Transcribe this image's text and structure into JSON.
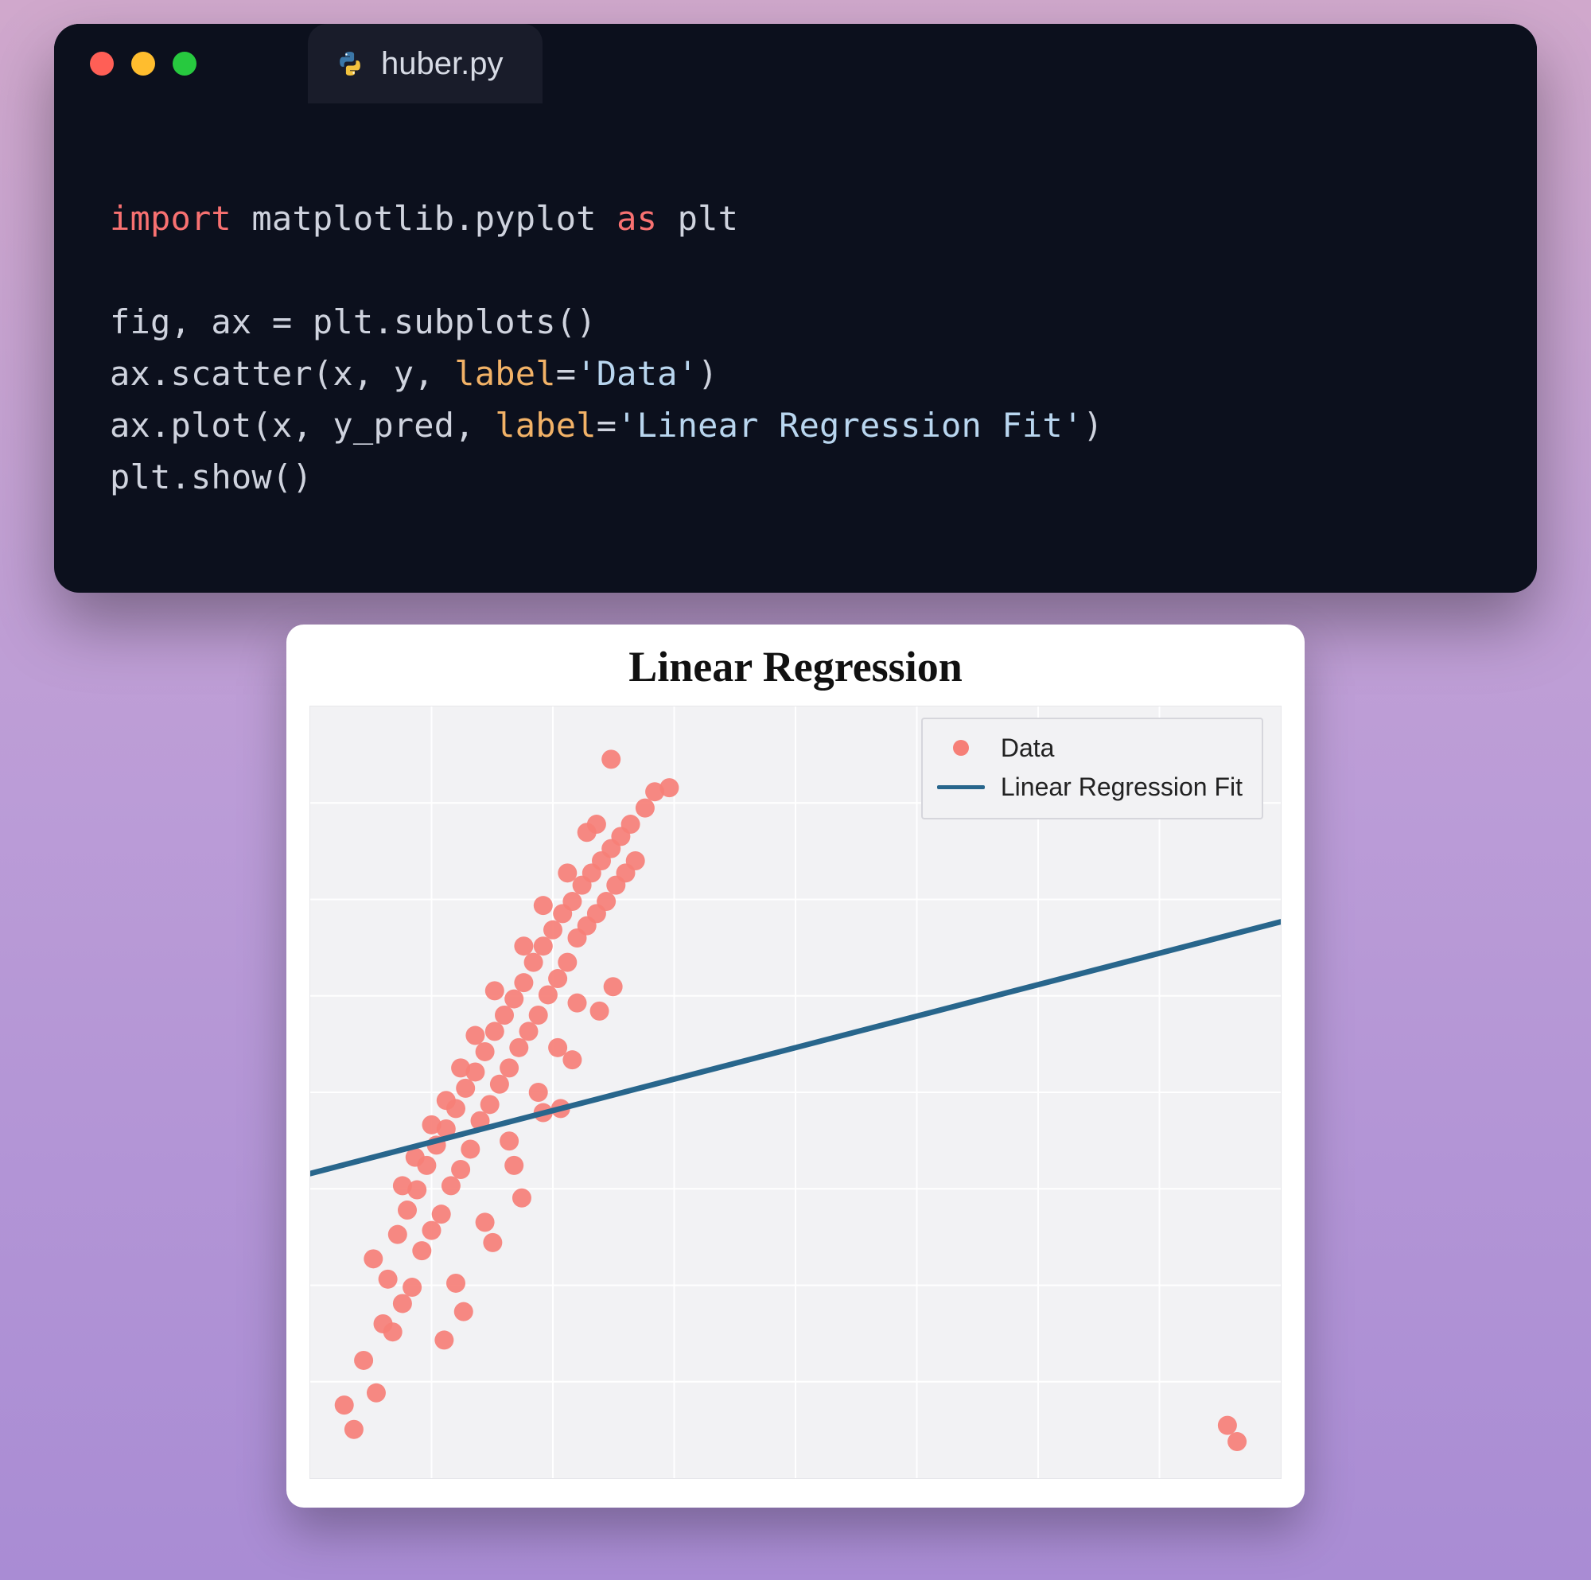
{
  "editor": {
    "tab_filename": "huber.py",
    "code_tokens": [
      [
        {
          "t": "import ",
          "c": "tok-kw"
        },
        {
          "t": "matplotlib.pyplot ",
          "c": "tok-id"
        },
        {
          "t": "as ",
          "c": "tok-kw"
        },
        {
          "t": "plt",
          "c": "tok-id"
        }
      ],
      [],
      [
        {
          "t": "fig, ax ",
          "c": "tok-id"
        },
        {
          "t": "= ",
          "c": "tok-op"
        },
        {
          "t": "plt.subplots()",
          "c": "tok-id"
        }
      ],
      [
        {
          "t": "ax.scatter(x, y, ",
          "c": "tok-id"
        },
        {
          "t": "label",
          "c": "tok-param"
        },
        {
          "t": "=",
          "c": "tok-op"
        },
        {
          "t": "'Data'",
          "c": "tok-str"
        },
        {
          "t": ")",
          "c": "tok-id"
        }
      ],
      [
        {
          "t": "ax.plot(x, y_pred, ",
          "c": "tok-id"
        },
        {
          "t": "label",
          "c": "tok-param"
        },
        {
          "t": "=",
          "c": "tok-op"
        },
        {
          "t": "'Linear Regression Fit'",
          "c": "tok-str"
        },
        {
          "t": ")",
          "c": "tok-id"
        }
      ],
      [
        {
          "t": "plt.show()",
          "c": "tok-id"
        }
      ]
    ]
  },
  "colors": {
    "scatter": "#f67f77",
    "line": "#28668c",
    "grid_bg": "#f2f2f4",
    "grid_line": "#ffffff"
  },
  "chart_data": {
    "type": "scatter+line",
    "title": "Linear Regression",
    "xlabel": "",
    "ylabel": "",
    "xlim": [
      0,
      10
    ],
    "ylim": [
      -1.5,
      8.0
    ],
    "grid": true,
    "legend_position": "upper right",
    "series": [
      {
        "name": "Data",
        "type": "scatter",
        "color": "#f67f77",
        "points": [
          [
            0.35,
            -0.6
          ],
          [
            0.45,
            -0.9
          ],
          [
            0.55,
            -0.05
          ],
          [
            0.68,
            -0.45
          ],
          [
            0.65,
            1.2
          ],
          [
            0.75,
            0.4
          ],
          [
            0.8,
            0.95
          ],
          [
            0.85,
            0.3
          ],
          [
            0.9,
            1.5
          ],
          [
            0.95,
            0.65
          ],
          [
            1.0,
            1.8
          ],
          [
            1.05,
            0.85
          ],
          [
            1.1,
            2.05
          ],
          [
            1.15,
            1.3
          ],
          [
            1.2,
            2.35
          ],
          [
            1.25,
            1.55
          ],
          [
            1.3,
            2.6
          ],
          [
            1.35,
            1.75
          ],
          [
            1.38,
            0.2
          ],
          [
            1.4,
            2.8
          ],
          [
            1.45,
            2.1
          ],
          [
            1.5,
            3.05
          ],
          [
            1.55,
            2.3
          ],
          [
            1.58,
            0.55
          ],
          [
            1.6,
            3.3
          ],
          [
            1.65,
            2.55
          ],
          [
            1.7,
            3.5
          ],
          [
            1.75,
            2.9
          ],
          [
            1.8,
            3.75
          ],
          [
            1.85,
            3.1
          ],
          [
            1.88,
            1.4
          ],
          [
            1.9,
            4.0
          ],
          [
            1.95,
            3.35
          ],
          [
            2.0,
            4.2
          ],
          [
            2.05,
            3.55
          ],
          [
            2.1,
            4.4
          ],
          [
            2.15,
            3.8
          ],
          [
            2.18,
            1.95
          ],
          [
            2.2,
            4.6
          ],
          [
            2.25,
            4.0
          ],
          [
            2.3,
            4.85
          ],
          [
            2.35,
            4.2
          ],
          [
            2.4,
            5.05
          ],
          [
            2.45,
            4.45
          ],
          [
            2.5,
            5.25
          ],
          [
            2.55,
            4.65
          ],
          [
            2.58,
            3.05
          ],
          [
            2.6,
            5.45
          ],
          [
            2.65,
            4.85
          ],
          [
            2.7,
            5.6
          ],
          [
            2.75,
            5.15
          ],
          [
            2.8,
            5.8
          ],
          [
            2.85,
            5.3
          ],
          [
            2.9,
            5.95
          ],
          [
            2.95,
            5.45
          ],
          [
            3.0,
            6.1
          ],
          [
            3.05,
            5.6
          ],
          [
            3.1,
            6.25
          ],
          [
            3.12,
            4.55
          ],
          [
            3.15,
            5.8
          ],
          [
            3.2,
            6.4
          ],
          [
            3.25,
            5.95
          ],
          [
            3.3,
            6.55
          ],
          [
            3.35,
            6.1
          ],
          [
            3.45,
            6.75
          ],
          [
            3.55,
            6.95
          ],
          [
            3.7,
            7.0
          ],
          [
            3.1,
            7.35
          ],
          [
            2.85,
            6.45
          ],
          [
            2.95,
            6.55
          ],
          [
            2.4,
            5.55
          ],
          [
            2.2,
            5.05
          ],
          [
            2.65,
            5.95
          ],
          [
            1.9,
            4.5
          ],
          [
            1.7,
            3.95
          ],
          [
            1.55,
            3.55
          ],
          [
            1.4,
            3.15
          ],
          [
            1.08,
            2.45
          ],
          [
            1.25,
            2.85
          ],
          [
            0.95,
            2.1
          ],
          [
            2.05,
            2.65
          ],
          [
            2.35,
            3.25
          ],
          [
            2.55,
            3.8
          ],
          [
            2.75,
            4.35
          ],
          [
            1.5,
            0.9
          ],
          [
            1.8,
            1.65
          ],
          [
            2.1,
            2.35
          ],
          [
            2.4,
            3.0
          ],
          [
            2.7,
            3.65
          ],
          [
            2.98,
            4.25
          ],
          [
            9.45,
            -0.85
          ],
          [
            9.55,
            -1.05
          ]
        ]
      },
      {
        "name": "Linear Regression Fit",
        "type": "line",
        "color": "#28668c",
        "points": [
          [
            0.0,
            2.25
          ],
          [
            10.0,
            5.35
          ]
        ]
      }
    ]
  }
}
